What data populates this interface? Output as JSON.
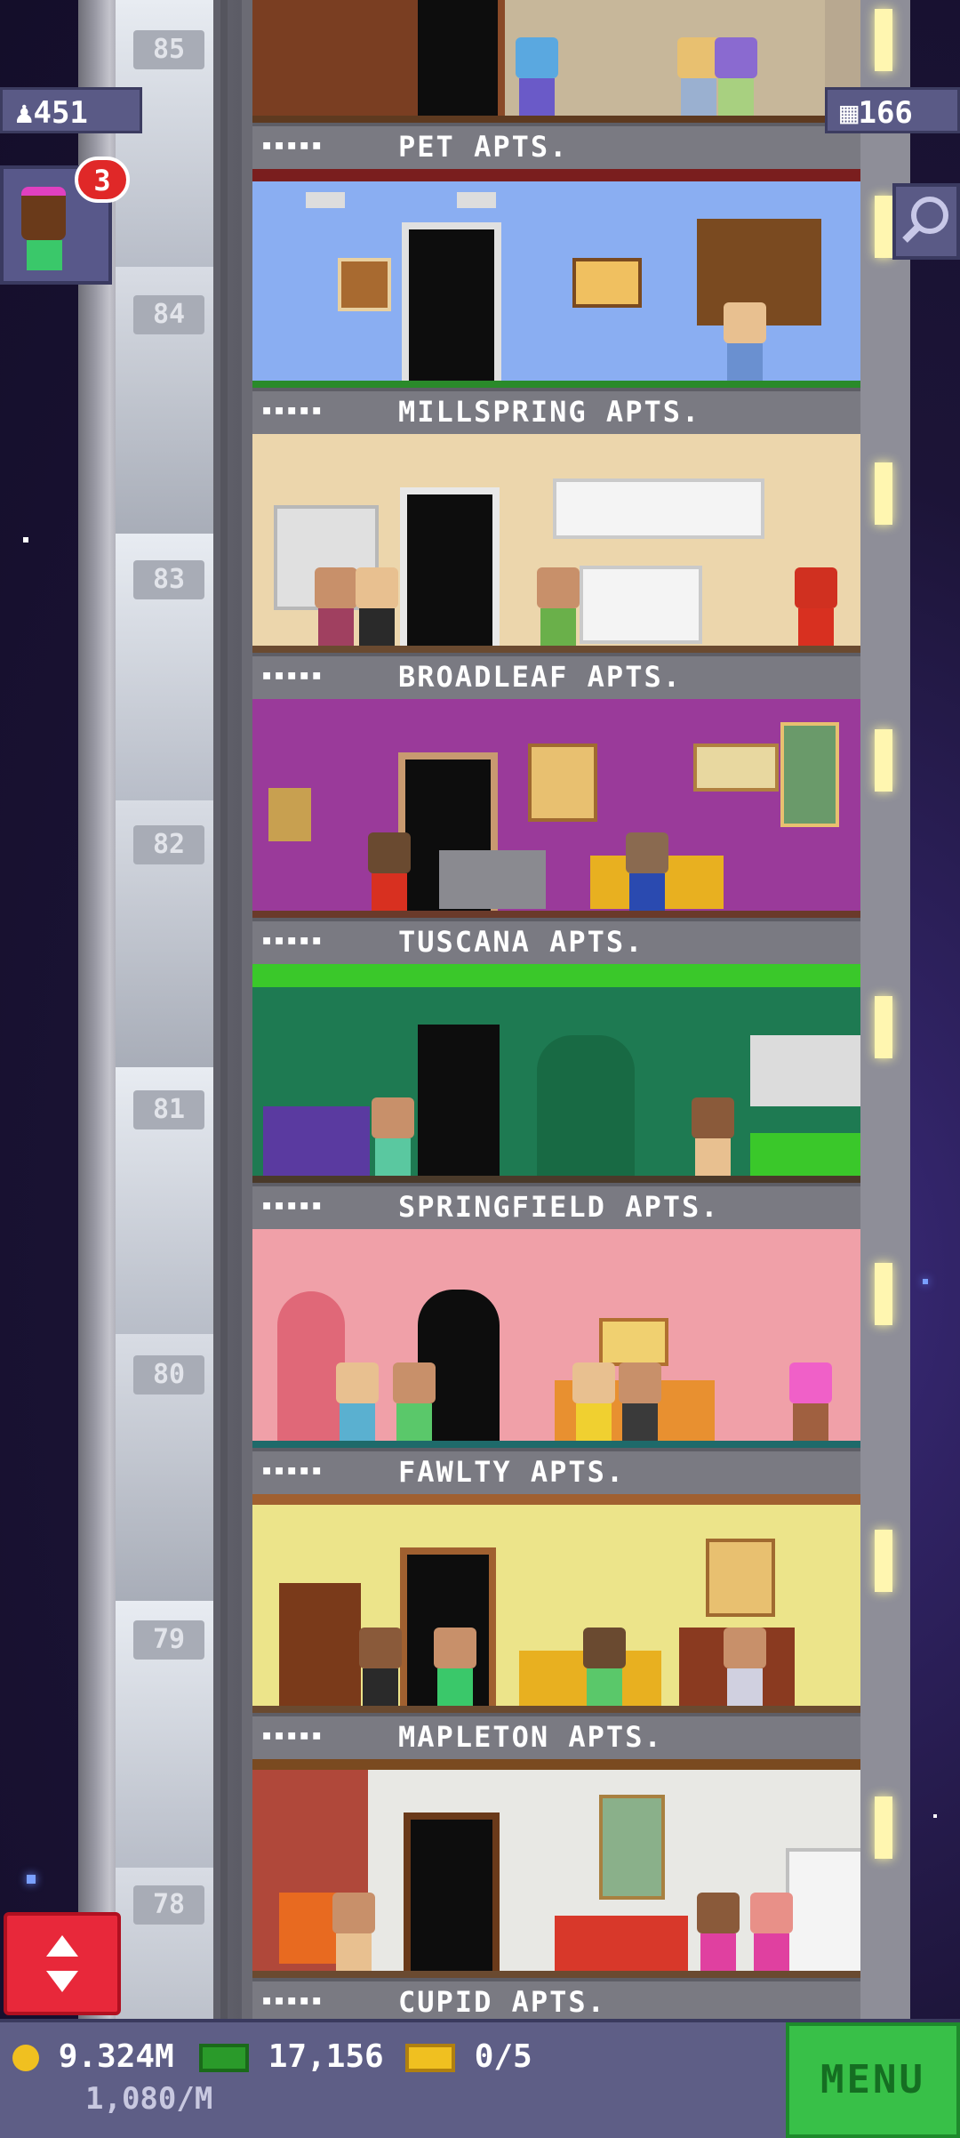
{
  "hud": {
    "population": "451",
    "units": "166",
    "visitor_notifications": "3",
    "coins": "9.324M",
    "coin_rate": "1,080/M",
    "bux": "17,156",
    "tickets": "0/5",
    "menu_label": "MENU"
  },
  "floors": [
    {
      "number": "85",
      "name": "PET APTS.",
      "stars": "▪▪▪▪▪"
    },
    {
      "number": "84",
      "name": "MILLSPRING APTS.",
      "stars": "▪▪▪▪▪"
    },
    {
      "number": "83",
      "name": "BROADLEAF APTS.",
      "stars": "▪▪▪▪▪"
    },
    {
      "number": "82",
      "name": "TUSCANA APTS.",
      "stars": "▪▪▪▪▪"
    },
    {
      "number": "81",
      "name": "SPRINGFIELD APTS.",
      "stars": "▪▪▪▪▪"
    },
    {
      "number": "80",
      "name": "FAWLTY APTS.",
      "stars": "▪▪▪▪▪"
    },
    {
      "number": "79",
      "name": "MAPLETON APTS.",
      "stars": "▪▪▪▪▪"
    },
    {
      "number": "78",
      "name": "CUPID APTS.",
      "stars": "▪▪▪▪▪"
    }
  ],
  "colors": {
    "menu_green": "#38c048",
    "hud_purple": "#5a5a86",
    "elevator_red": "#e8283a",
    "notification_red": "#e02828"
  },
  "icons": [
    "population-icon",
    "units-icon",
    "search-icon",
    "elevator-arrows-icon",
    "coin-icon",
    "bux-icon",
    "ticket-icon"
  ]
}
